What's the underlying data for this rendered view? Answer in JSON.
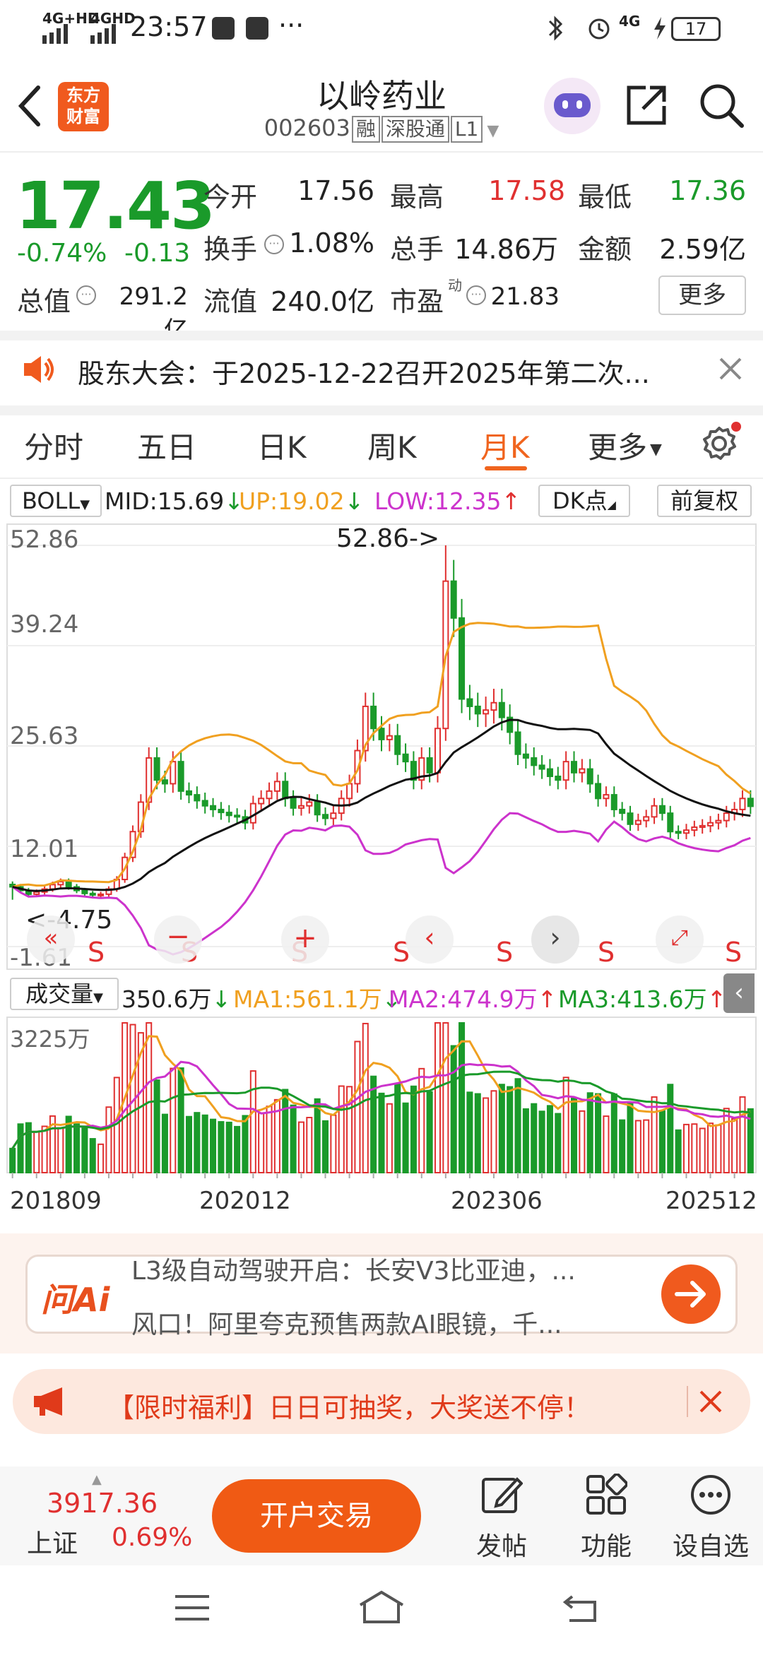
{
  "status_bar": {
    "net1": "4G+HD",
    "net2": "4GHD",
    "time": "23:57",
    "dots": "···",
    "net3": "4G",
    "battery": "17"
  },
  "header": {
    "logo_line1": "东方",
    "logo_line2": "财富",
    "title": "以岭药业",
    "code": "002603",
    "tag_margin": "融",
    "tag_connect": "深股通",
    "tag_level": "L1"
  },
  "quote": {
    "price": "17.43",
    "change_pct": "-0.74%",
    "change_abs": "-0.13",
    "open_label": "今开",
    "open_value": "17.56",
    "high_label": "最高",
    "high_value": "17.58",
    "low_label": "最低",
    "low_value": "17.36",
    "turnover_label": "换手",
    "turnover_value": "1.08%",
    "volume_label": "总手",
    "volume_value": "14.86万",
    "amount_label": "金额",
    "amount_value": "2.59亿",
    "mktcap_label": "总值",
    "mktcap_value": "291.2亿",
    "float_label": "流值",
    "float_value": "240.0亿",
    "pe_label": "市盈",
    "pe_sup": "动",
    "pe_value": "21.83",
    "more_label": "更多"
  },
  "notice": {
    "text": "股东大会：于2025-12-22召开2025年第二次..."
  },
  "tabs": [
    {
      "label": "分时"
    },
    {
      "label": "五日"
    },
    {
      "label": "日K"
    },
    {
      "label": "周K"
    },
    {
      "label": "月K"
    },
    {
      "label": "更多"
    }
  ],
  "indicator": {
    "name": "BOLL",
    "mid": "MID:15.69",
    "up": "UP:19.02",
    "low": "LOW:12.35",
    "dk_label": "DK点",
    "adjust_label": "前复权"
  },
  "price_axis": [
    "52.86",
    "39.24",
    "25.63",
    "12.01",
    "-1.61"
  ],
  "annotations": {
    "max_marker": "52.86->",
    "min_marker": "<-4.75",
    "sell_mark": "S"
  },
  "volume_indicator": {
    "name": "成交量",
    "value": "350.6万",
    "ma1": "MA1:561.1万",
    "ma2": "MA2:474.9万",
    "ma3": "MA3:413.6万",
    "axis_max": "3225万"
  },
  "x_axis": [
    "201809",
    "202012",
    "202306",
    "202512"
  ],
  "colors": {
    "up": "#e03030",
    "down": "#1a9a2a",
    "boll_mid": "#111111",
    "boll_up": "#f0a020",
    "boll_low": "#cc33cc",
    "ma1": "#f0a020",
    "ma2": "#cc33cc",
    "ma3": "#1a9a2a",
    "accent": "#f0641e"
  },
  "ask_ai": {
    "logo": "问Ai",
    "line1": "L3级自动驾驶开启：长安V3比亚迪，...",
    "line2": "风口！阿里夸克预售两款AI眼镜，千..."
  },
  "promo": {
    "text": "【限时福利】日日可抽奖，大奖送不停！"
  },
  "bottom_bar": {
    "index_value": "3917.36",
    "index_name": "上证",
    "index_pct": "0.69%",
    "trade_label": "开户交易",
    "post_label": "发帖",
    "function_label": "功能",
    "watch_label": "设自选"
  },
  "chart_data": {
    "type": "candlestick",
    "period": "monthly",
    "x_labels": [
      "201809",
      "202012",
      "202306",
      "202512"
    ],
    "y_ticks": [
      52.86,
      39.24,
      25.63,
      12.01,
      -1.61
    ],
    "ylim": [
      -1.61,
      52.86
    ],
    "max_marker": 52.86,
    "min_marker": 4.75,
    "close": [
      6.5,
      6.0,
      5.5,
      5.8,
      6.2,
      6.8,
      7.2,
      6.5,
      6.0,
      5.6,
      5.4,
      5.5,
      6.2,
      7.5,
      10.5,
      14.0,
      18.0,
      24.0,
      21.0,
      20.5,
      23.5,
      19.5,
      19.0,
      18.2,
      17.5,
      17.0,
      16.6,
      16.2,
      16.0,
      15.2,
      17.8,
      18.5,
      19.5,
      20.8,
      18.5,
      17.2,
      17.5,
      18.0,
      16.3,
      15.8,
      16.5,
      18.5,
      20.5,
      25.0,
      31.0,
      28.0,
      26.5,
      27.0,
      24.5,
      23.5,
      21.0,
      24.0,
      22.0,
      28.0,
      48.0,
      43.0,
      32.0,
      31.0,
      30.0,
      30.5,
      31.5,
      29.5,
      27.5,
      24.5,
      24.0,
      23.0,
      22.5,
      21.5,
      21.0,
      23.5,
      22.0,
      22.5,
      20.5,
      18.5,
      19.0,
      17.0,
      16.5,
      15.0,
      15.5,
      16.0,
      17.5,
      16.5,
      14.0,
      13.8,
      14.2,
      14.6,
      14.8,
      15.2,
      15.5,
      16.5,
      17.0,
      18.5,
      17.43
    ],
    "boll_mid_current": 15.69,
    "boll_up_current": 19.02,
    "boll_low_current": 12.35,
    "volume_axis_max": "3225万",
    "volume_current": "350.6万",
    "ma1_current": "561.1万",
    "ma2_current": "474.9万",
    "ma3_current": "413.6万"
  }
}
